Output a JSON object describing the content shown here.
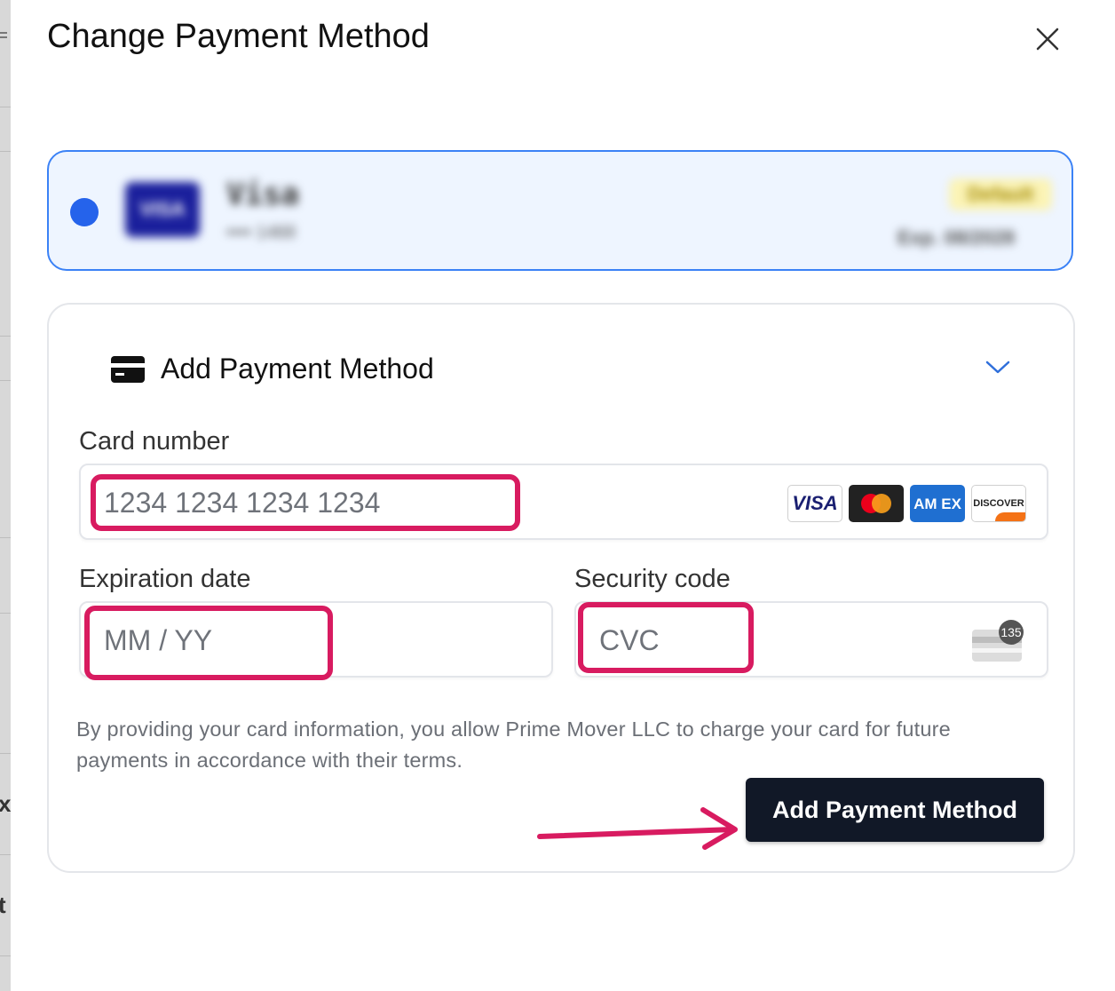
{
  "modal": {
    "title": "Change Payment Method",
    "close_icon": "close-icon"
  },
  "saved_card": {
    "brand": "Visa",
    "brand_logo_text": "VISA",
    "number_masked": "•••• 1468",
    "badge": "Default",
    "expiry": "Exp. 08/2028",
    "selected": true
  },
  "add_panel": {
    "title": "Add Payment Method",
    "icon": "credit-card-icon",
    "chevron_icon": "chevron-down-icon",
    "card_number": {
      "label": "Card number",
      "placeholder": "1234 1234 1234 1234",
      "value": ""
    },
    "expiration": {
      "label": "Expiration date",
      "placeholder": "MM / YY",
      "value": ""
    },
    "security": {
      "label": "Security code",
      "placeholder": "CVC",
      "value": "",
      "icon_badge": "135"
    },
    "accepted_brands": {
      "visa": "VISA",
      "mastercard": "mastercard-icon",
      "amex": "AM EX",
      "discover": "DISCOVER"
    },
    "disclaimer": "By providing your card information, you allow Prime Mover LLC to charge your card for future payments in accordance with their terms.",
    "submit_label": "Add Payment Method"
  },
  "colors": {
    "selected_border": "#3b82f6",
    "selected_bg": "#eef5ff",
    "annotation": "#d81b60",
    "button_bg": "#111827"
  }
}
